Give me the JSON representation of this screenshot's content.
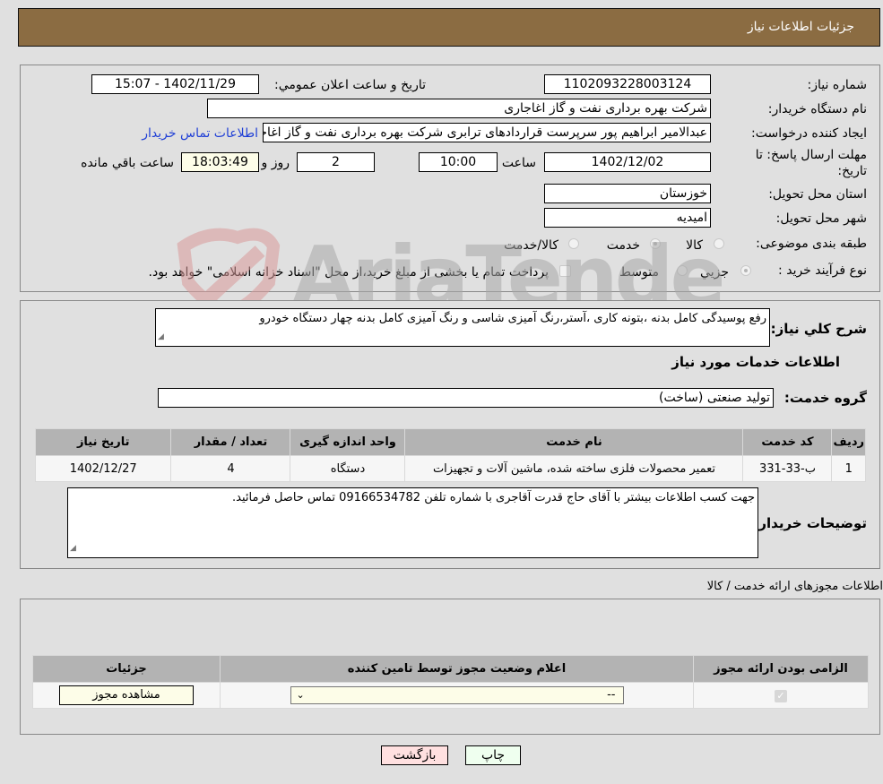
{
  "header": {
    "title": "جزئیات اطلاعات نیاز"
  },
  "form": {
    "need_number": {
      "label": "شماره نیاز:",
      "value": "1102093228003124"
    },
    "announce_datetime": {
      "label": "تاريخ و ساعت اعلان عمومي:",
      "value": "1402/11/29 - 15:07"
    },
    "buyer_org": {
      "label": "نام دستگاه خريدار:",
      "value": "شرکت بهره برداری نفت و گاز اغاجاری"
    },
    "requester": {
      "label": "ايجاد کننده درخواست:",
      "value": "عبدالامیر ابراهیم پور سرپرست قراردادهای ترابری شرکت بهره برداری نفت و گاز اغاجاری",
      "contact_link": "اطلاعات تماس خريدار"
    },
    "deadline": {
      "label": "مهلت ارسال پاسخ: تا تاريخ:",
      "date": "1402/12/02",
      "time_label": "ساعت",
      "time": "10:00",
      "days": "2",
      "days_label": "روز و",
      "remaining": "18:03:49",
      "remaining_label": "ساعت باقي مانده"
    },
    "province": {
      "label": "استان محل تحويل:",
      "value": "خوزستان"
    },
    "city": {
      "label": "شهر محل تحويل:",
      "value": "امیدیه"
    },
    "category": {
      "label": "طبقه بندی موضوعی:",
      "options": [
        "کالا",
        "خدمت",
        "کالا/خدمت"
      ],
      "selected": "خدمت"
    },
    "purchase_type": {
      "label": "نوع فرآيند خريد :",
      "options": [
        "جزيي",
        "متوسط"
      ],
      "selected": "جزيي",
      "treasury_note": "پرداخت تمام يا بخشی از مبلغ خريد،از محل \"اسناد خزانه اسلامی\" خواهد بود."
    }
  },
  "description": {
    "label": "شرح کلي نياز:",
    "value": "رفع پوسیدگی کامل بدنه ،بتونه کاری ،آستر،رنگ آمیزی شاسی و رنگ آمیزی کامل بدنه چهار دستگاه خودرو"
  },
  "services_section": {
    "title": "اطلاعات خدمات مورد نياز",
    "group_label": "گروه خدمت:",
    "group_value": "تولید صنعتی (ساخت)",
    "table": {
      "headers": [
        "رديف",
        "کد خدمت",
        "نام خدمت",
        "واحد اندازه گيری",
        "تعداد / مقدار",
        "تاريخ نياز"
      ],
      "rows": [
        [
          "1",
          "ب-33-331",
          "تعمیر محصولات فلزی ساخته شده، ماشین آلات و تجهیزات",
          "دستگاه",
          "4",
          "1402/12/27"
        ]
      ]
    }
  },
  "buyer_notes": {
    "label": "توضيحات خريدار:",
    "value": "جهت کسب اطلاعات بیشتر با آقای حاج قدرت آقاجری با شماره تلفن 09166534782 تماس حاصل فرمائید."
  },
  "permits": {
    "title": "اطلاعات مجوزهای ارائه خدمت / کالا",
    "headers": [
      "الزامی بودن ارائه مجوز",
      "اعلام وضعيت مجوز توسط تامين کننده",
      "جزئيات"
    ],
    "row": {
      "required_checked": true,
      "status_selected": "--",
      "details_button": "مشاهده مجوز"
    }
  },
  "buttons": {
    "print": "چاپ",
    "back": "بازگشت"
  },
  "watermark": {
    "text": "AriaTender.neT"
  }
}
